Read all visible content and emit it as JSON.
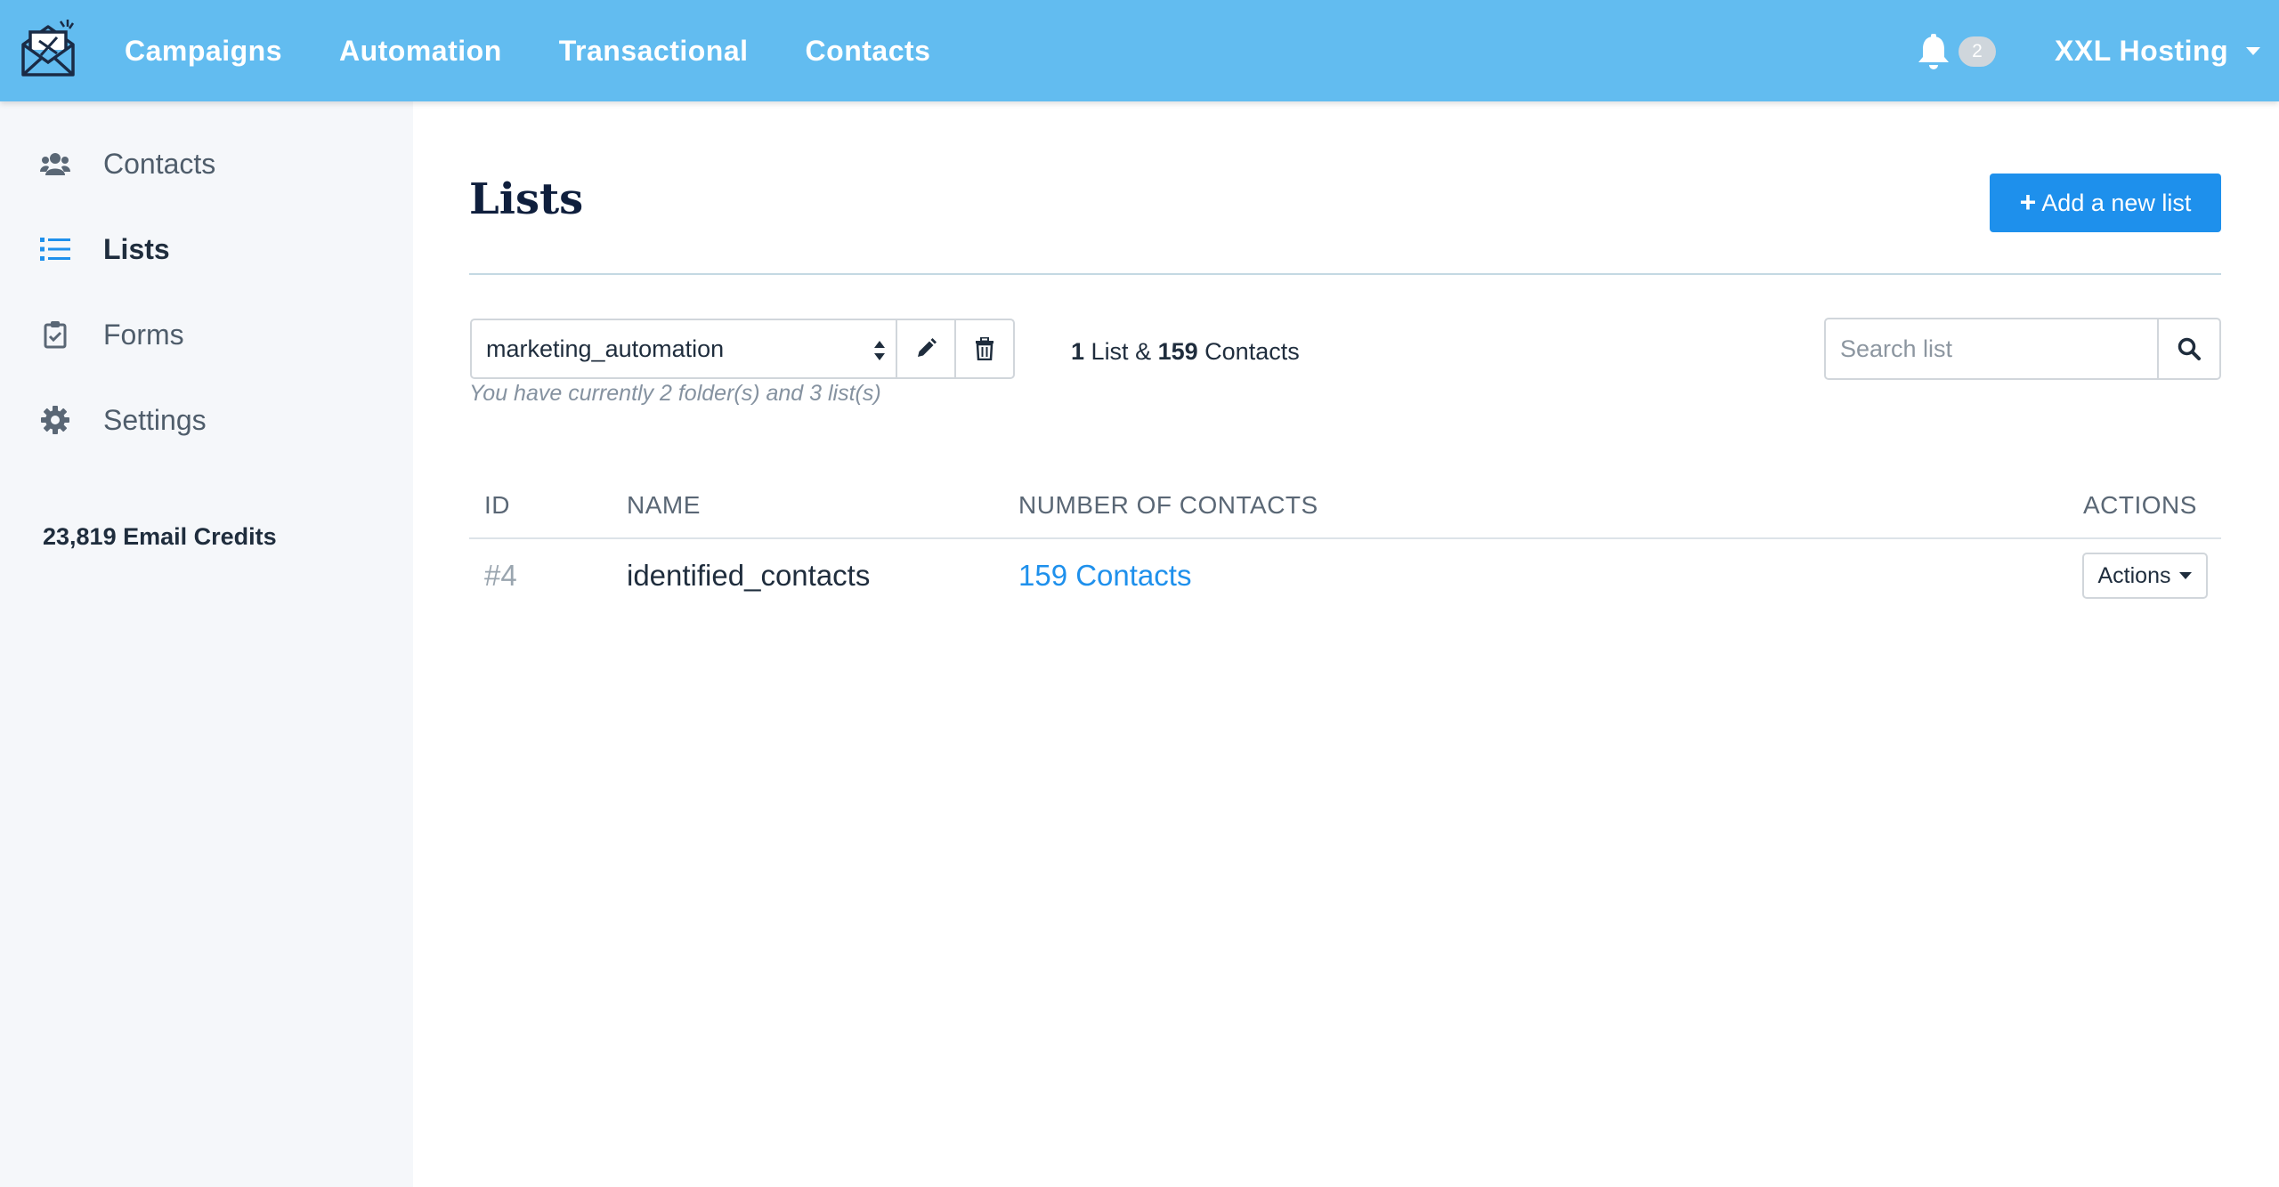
{
  "colors": {
    "navbar": "#62bcf0",
    "primary": "#1e90ec",
    "sidebar_bg": "#f5f7fa",
    "title": "#0f1f3d"
  },
  "nav": {
    "links": [
      "Campaigns",
      "Automation",
      "Transactional",
      "Contacts"
    ],
    "notification_count": "2",
    "account_name": "XXL Hosting"
  },
  "sidebar": {
    "items": [
      {
        "label": "Contacts",
        "icon": "users-icon"
      },
      {
        "label": "Lists",
        "icon": "list-icon",
        "active": true
      },
      {
        "label": "Forms",
        "icon": "clipboard-check-icon"
      },
      {
        "label": "Settings",
        "icon": "gear-icon"
      }
    ],
    "credits": "23,819 Email Credits"
  },
  "main": {
    "title": "Lists",
    "add_button": "Add a new list",
    "folder": {
      "selected": "marketing_automation",
      "hint": "You have currently 2 folder(s) and 3 list(s)"
    },
    "summary": {
      "list_count": "1",
      "list_word": "List &",
      "contact_count": "159",
      "contact_word": "Contacts"
    },
    "search": {
      "placeholder": "Search list"
    },
    "table": {
      "columns": [
        "ID",
        "NAME",
        "NUMBER OF CONTACTS",
        "ACTIONS"
      ],
      "rows": [
        {
          "id": "#4",
          "name": "identified_contacts",
          "contacts": "159 Contacts",
          "action": "Actions"
        }
      ]
    }
  }
}
